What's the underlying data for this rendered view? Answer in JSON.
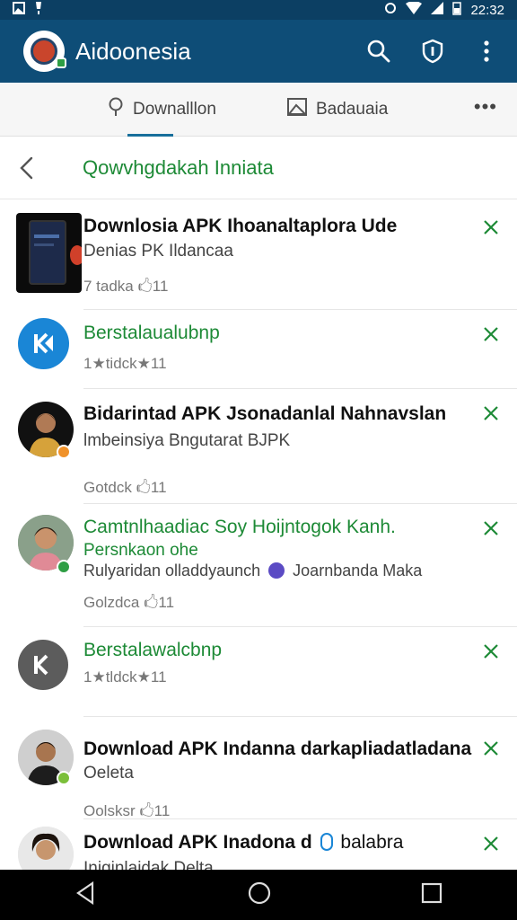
{
  "status_bar": {
    "time": "22:32"
  },
  "app_bar": {
    "title": "Aidoonesia"
  },
  "tabs": [
    {
      "label": "Downalllon",
      "icon": "pin-icon"
    },
    {
      "label": "Badauaia",
      "icon": "photo-icon"
    }
  ],
  "tabs_more": "•••",
  "subheader": {
    "title": "Qowvhgdakah Inniata"
  },
  "list": [
    {
      "title": "Downlosia APK Ihoanaltaplora Ude",
      "subtitle": "Denias PK Ildancaa",
      "meta": "7 tadka 🖒11"
    },
    {
      "title": "Berstalaualubnp",
      "meta": "1★tidck★11"
    },
    {
      "title": "Bidarintad APK Jsonadanlal Nahnavslan",
      "subtitle": "lmbeinsiya Bngutarat BJPK",
      "meta": "Gotdck 🖒11"
    },
    {
      "title": "Camtnlhaadiac Soy Hoijntogok Kanh.",
      "subtitle": "Persnkaon ohe",
      "subtitle2": "Rulyaridan olladdyaunch",
      "subtitle2b": "Joarnbanda Maka",
      "meta": "Golzdca 🖒11"
    },
    {
      "title": "Berstalawalcbnp",
      "meta": "1★tldck★11"
    },
    {
      "title": "Download APK Indanna darkapliadatladana",
      "subtitle": "Oeleta",
      "meta": "Oolsksr 🖒11"
    },
    {
      "title": "Download APK Inadona d",
      "title_tail": "balabra",
      "subtitle": "Iniginlaidak Delta"
    }
  ],
  "colors": {
    "app_bar": "#0e4d77",
    "accent_green": "#1d8a36",
    "tab_underline": "#176f9b"
  }
}
